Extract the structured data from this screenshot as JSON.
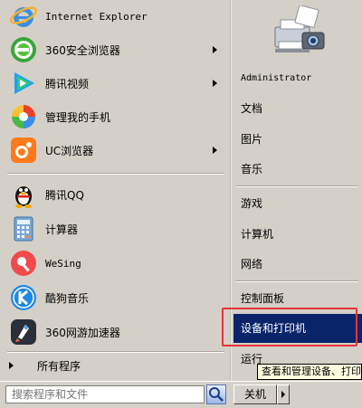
{
  "left_items": [
    {
      "label": "Internet Explorer",
      "icon": "internet-explorer-icon",
      "submenu": false
    },
    {
      "label": "360安全浏览器",
      "icon": "360-browser-icon",
      "submenu": true
    },
    {
      "label": "腾讯视频",
      "icon": "tencent-video-icon",
      "submenu": true
    },
    {
      "label": "管理我的手机",
      "icon": "phone-manager-icon",
      "submenu": false
    },
    {
      "label": "UC浏览器",
      "icon": "uc-browser-icon",
      "submenu": true
    },
    {
      "label": "腾讯QQ",
      "icon": "qq-penguin-icon",
      "submenu": false
    },
    {
      "label": "计算器",
      "icon": "calculator-icon",
      "submenu": false
    },
    {
      "label": "WeSing",
      "icon": "wesing-icon",
      "submenu": false
    },
    {
      "label": "酷狗音乐",
      "icon": "kugou-music-icon",
      "submenu": false
    },
    {
      "label": "360网游加速器",
      "icon": "360-game-accelerator-icon",
      "submenu": false
    }
  ],
  "all_programs": "所有程序",
  "right_items": {
    "user": "Administrator",
    "documents": "文档",
    "pictures": "图片",
    "music": "音乐",
    "games": "游戏",
    "computer": "计算机",
    "network": "网络",
    "control_panel": "控制面板",
    "devices_printers": "设备和打印机",
    "run": "运行"
  },
  "tooltip": "查看和管理设备、打印机",
  "search": {
    "placeholder": "搜索程序和文件"
  },
  "shutdown_label": "关机",
  "colors": {
    "menu_bg": "#d4d0c8",
    "selection": "#0a246a",
    "highlight_box": "#e8333a",
    "tooltip_bg": "#ffffe1"
  }
}
